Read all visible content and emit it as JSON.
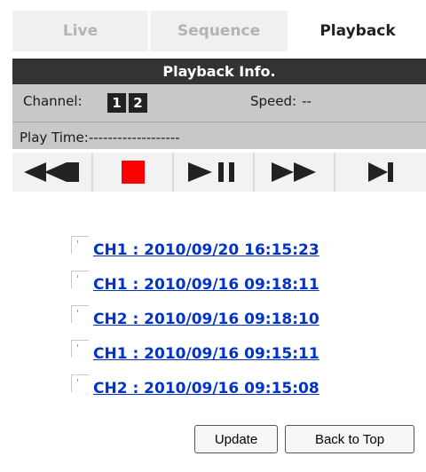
{
  "tabs": [
    {
      "label": "Live",
      "active": false
    },
    {
      "label": "Sequence",
      "active": false
    },
    {
      "label": "Playback",
      "active": true
    }
  ],
  "info": {
    "title": "Playback Info.",
    "channel_label": "Channel:",
    "channels": [
      "1",
      "2"
    ],
    "speed_label": "Speed:",
    "speed_value": "--",
    "play_time_label": "Play Time:",
    "play_time_value": "-------------------"
  },
  "controls": [
    {
      "icon": "rewind-icon"
    },
    {
      "icon": "stop-icon"
    },
    {
      "icon": "play-pause-icon"
    },
    {
      "icon": "fast-forward-icon"
    },
    {
      "icon": "step-forward-icon"
    }
  ],
  "records": [
    "CH1 : 2010/09/20 16:15:23",
    "CH1 : 2010/09/16 09:18:11",
    "CH2 : 2010/09/16 09:18:10",
    "CH1 : 2010/09/16 09:15:11",
    "CH2 : 2010/09/16 09:15:08"
  ],
  "buttons": {
    "update": "Update",
    "back_to_top": "Back to Top"
  },
  "colors": {
    "header_bg": "#333333",
    "info_bg": "#c8c8c8",
    "stop": "#ff0000",
    "link": "#0033cc",
    "icon": "#222222"
  }
}
